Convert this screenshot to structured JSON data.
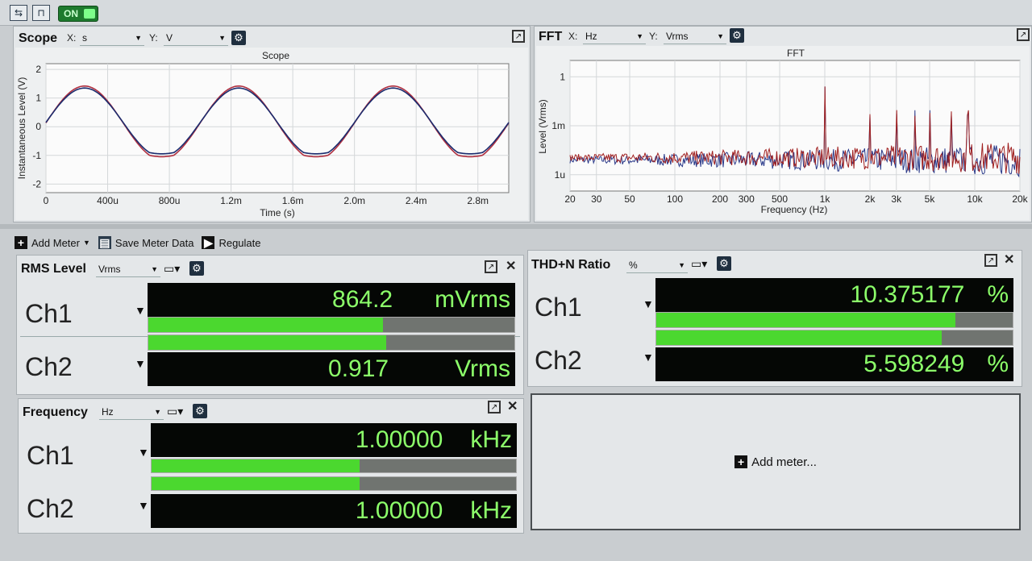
{
  "toolbar": {
    "on_label": "ON"
  },
  "scope": {
    "title": "Scope",
    "x_label": "X:",
    "x_unit": "s",
    "y_label": "Y:",
    "y_unit": "V",
    "plot_title": "Scope",
    "xlabel": "Time (s)",
    "ylabel": "Instantaneous Level (V)",
    "x_ticks": [
      "0",
      "400u",
      "800u",
      "1.2m",
      "1.6m",
      "2.0m",
      "2.4m",
      "2.8m"
    ],
    "y_ticks": [
      "2",
      "1",
      "0",
      "-1",
      "-2"
    ],
    "colors": {
      "ch1": "#1b2c6e",
      "ch2": "#b03040"
    }
  },
  "fft": {
    "title": "FFT",
    "x_label": "X:",
    "x_unit": "Hz",
    "y_label": "Y:",
    "y_unit": "Vrms",
    "plot_title": "FFT",
    "xlabel": "Frequency (Hz)",
    "ylabel": "Level (Vrms)",
    "x_ticks": [
      "20",
      "30",
      "50",
      "100",
      "200",
      "300",
      "500",
      "1k",
      "2k",
      "3k",
      "5k",
      "10k",
      "20k"
    ],
    "y_ticks": [
      "1",
      "1m",
      "1u"
    ],
    "colors": {
      "ch1": "#2a3a8a",
      "ch2": "#a02020"
    }
  },
  "meter_toolbar": {
    "add_meter": "Add Meter",
    "save_meter_data": "Save Meter Data",
    "regulate": "Regulate"
  },
  "rms": {
    "title": "RMS Level",
    "unit_select": "Vrms",
    "ch1": {
      "label": "Ch1",
      "value": "864.2",
      "unit": "mVrms",
      "bar_level": 0.64
    },
    "ch2": {
      "label": "Ch2",
      "value": "0.917",
      "unit": "Vrms",
      "bar_level": 0.65
    }
  },
  "thd": {
    "title": "THD+N Ratio",
    "unit_select": "%",
    "ch1": {
      "label": "Ch1",
      "value": "10.375177",
      "unit": "%",
      "bar_level": 0.84
    },
    "ch2": {
      "label": "Ch2",
      "value": "5.598249",
      "unit": "%",
      "bar_level": 0.8
    }
  },
  "frequency": {
    "title": "Frequency",
    "unit_select": "Hz",
    "ch1": {
      "label": "Ch1",
      "value": "1.00000",
      "unit": "kHz",
      "bar_level": 0.57
    },
    "ch2": {
      "label": "Ch2",
      "value": "1.00000",
      "unit": "kHz",
      "bar_level": 0.57
    }
  },
  "add_meter_area": {
    "label": "Add meter..."
  },
  "chart_data": [
    {
      "type": "line",
      "title": "Scope",
      "xlabel": "Time (s)",
      "ylabel": "Instantaneous Level (V)",
      "xlim": [
        0,
        0.003
      ],
      "ylim": [
        -2.3,
        2.2
      ],
      "grid": true,
      "series": [
        {
          "frequency_hz": 1000,
          "peak_high": 1.35,
          "peak_low": -1.05,
          "color": "#1b2c6e"
        },
        {
          "frequency_hz": 1000,
          "peak_high": 1.42,
          "peak_low": -1.15,
          "color": "#b03040"
        }
      ]
    },
    {
      "type": "line",
      "title": "FFT",
      "xlabel": "Frequency (Hz)",
      "ylabel": "Level (Vrms)",
      "x_scale": "log",
      "y_scale": "log",
      "xlim": [
        20,
        20000
      ],
      "ylim": [
        1e-07,
        10
      ],
      "grid": true,
      "peaks_hz": [
        1000,
        2000,
        3000,
        4000,
        5000,
        7000,
        9000
      ],
      "noise_floor_vrms": 1e-05
    }
  ]
}
